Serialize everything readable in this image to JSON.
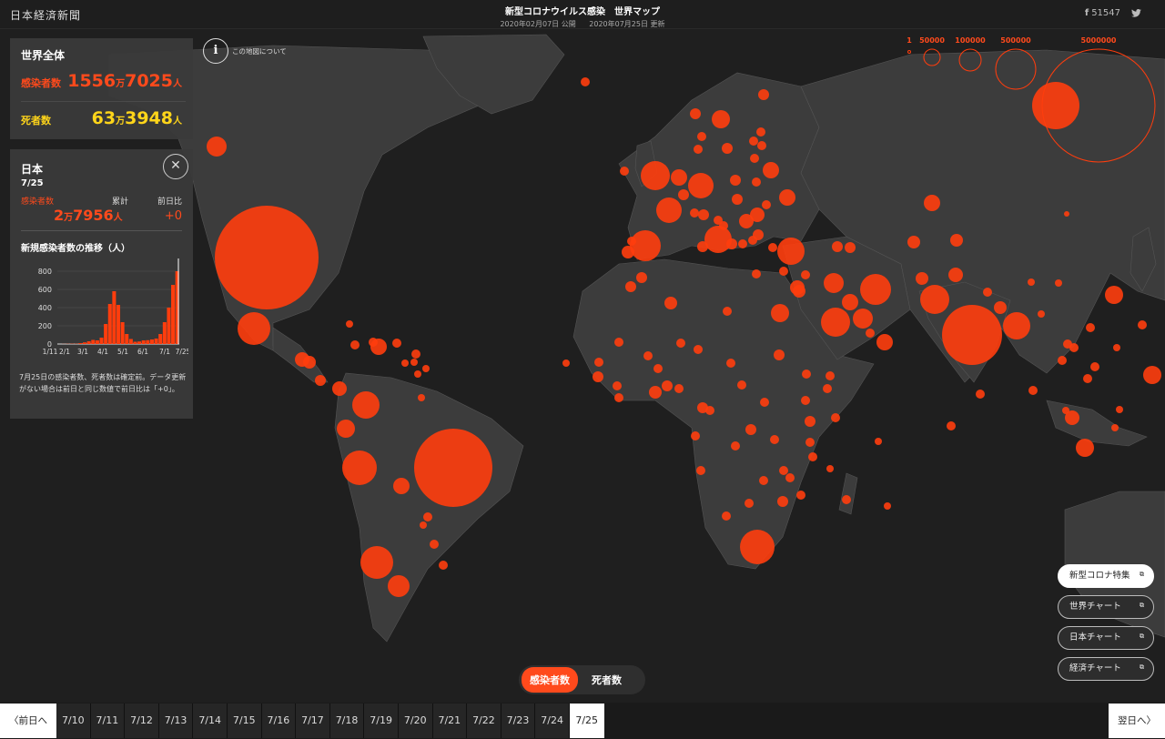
{
  "header": {
    "logo": "日本経済新聞",
    "title": "新型コロナウイルス感染　世界マップ",
    "published": "2020年02月07日 公開",
    "updated": "2020年07月25日 更新",
    "share_count": "51547"
  },
  "world": {
    "title": "世界全体",
    "cases_label": "感染者数",
    "cases_main": "1556",
    "cases_unit_man": "万",
    "cases_rest": "7025",
    "cases_unit": "人",
    "deaths_label": "死者数",
    "deaths_main": "63",
    "deaths_unit_man": "万",
    "deaths_rest": "3948",
    "deaths_unit": "人"
  },
  "japan": {
    "title": "日本",
    "date": "7/25",
    "col_cases": "感染者数",
    "col_total": "累計",
    "col_diff": "前日比",
    "total_main": "2",
    "total_unit_man": "万",
    "total_rest": "7956",
    "total_unit": "人",
    "diff": "+0",
    "chart_title": "新規感染者数の推移（人）",
    "note": "7月25日の感染者数、死者数は確定前。データ更新がない場合は前日と同じ数値で前日比は「+0」。"
  },
  "chart_data": {
    "type": "bar",
    "title": "新規感染者数の推移（人）",
    "x_tick_labels": [
      "1/11",
      "2/1",
      "3/1",
      "4/1",
      "5/1",
      "6/1",
      "7/1",
      "7/25"
    ],
    "y_ticks": [
      0,
      200,
      400,
      600,
      800
    ],
    "ylim": [
      0,
      900
    ],
    "weekly_new_cases_per_day": [
      {
        "week": "1/11",
        "value": 0
      },
      {
        "week": "1/18",
        "value": 1
      },
      {
        "week": "1/25",
        "value": 2
      },
      {
        "week": "2/1",
        "value": 3
      },
      {
        "week": "2/8",
        "value": 3
      },
      {
        "week": "2/15",
        "value": 10
      },
      {
        "week": "2/22",
        "value": 18
      },
      {
        "week": "2/29",
        "value": 30
      },
      {
        "week": "3/7",
        "value": 45
      },
      {
        "week": "3/14",
        "value": 40
      },
      {
        "week": "3/21",
        "value": 70
      },
      {
        "week": "3/28",
        "value": 220
      },
      {
        "week": "4/4",
        "value": 440
      },
      {
        "week": "4/11",
        "value": 580
      },
      {
        "week": "4/18",
        "value": 430
      },
      {
        "week": "4/25",
        "value": 240
      },
      {
        "week": "5/2",
        "value": 110
      },
      {
        "week": "5/9",
        "value": 55
      },
      {
        "week": "5/16",
        "value": 25
      },
      {
        "week": "5/23",
        "value": 28
      },
      {
        "week": "5/30",
        "value": 40
      },
      {
        "week": "6/6",
        "value": 42
      },
      {
        "week": "6/13",
        "value": 50
      },
      {
        "week": "6/20",
        "value": 60
      },
      {
        "week": "6/27",
        "value": 110
      },
      {
        "week": "7/4",
        "value": 240
      },
      {
        "week": "7/11",
        "value": 400
      },
      {
        "week": "7/18",
        "value": 650
      },
      {
        "week": "7/25",
        "value": 800
      }
    ]
  },
  "map": {
    "info_text": "この地図について",
    "legend": [
      "1",
      "50000",
      "100000",
      "500000",
      "5000000"
    ],
    "marker_color": "#ff3d0d"
  },
  "links": [
    {
      "label": "新型コロナ特集"
    },
    {
      "label": "世界チャート"
    },
    {
      "label": "日本チャート"
    },
    {
      "label": "経済チャート"
    }
  ],
  "toggle": {
    "cases": "感染者数",
    "deaths": "死者数"
  },
  "datebar": {
    "prev": "前日へ",
    "next": "翌日へ",
    "dates": [
      "7/10",
      "7/11",
      "7/12",
      "7/13",
      "7/14",
      "7/15",
      "7/16",
      "7/17",
      "7/18",
      "7/19",
      "7/20",
      "7/21",
      "7/22",
      "7/23",
      "7/24",
      "7/25"
    ],
    "selected": "7/25"
  }
}
